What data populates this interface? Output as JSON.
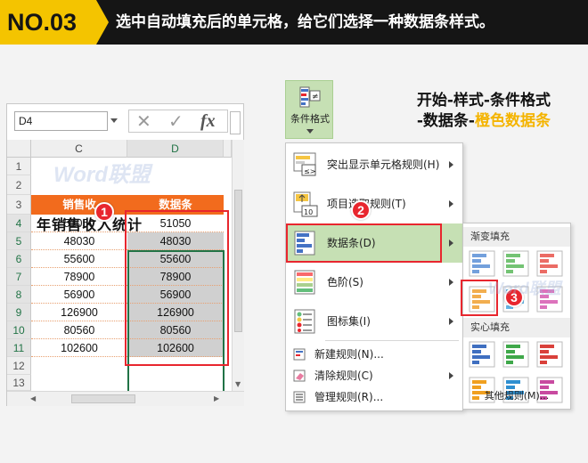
{
  "header": {
    "badge": "NO.03",
    "title": "选中自动填充后的单元格，给它们选择一种数据条样式。"
  },
  "instruction": {
    "line1": "开始-样式-条件格式",
    "line2_prefix": "-数据条-",
    "line2_highlight": "橙色数据条"
  },
  "excel": {
    "namebox": "D4",
    "formula_icons": {
      "cancel": "✕",
      "enter": "✓",
      "fx": "fx"
    },
    "columns": [
      "C",
      "D"
    ],
    "rows": [
      "1",
      "2",
      "3",
      "4",
      "5",
      "6",
      "7",
      "8",
      "9",
      "10",
      "11",
      "12",
      "13"
    ],
    "sheet_title": "年销售收入统计",
    "header_c": "销售收",
    "header_d": "数据条",
    "values": [
      "51050",
      "48030",
      "55600",
      "78900",
      "56900",
      "126900",
      "80560",
      "102600"
    ]
  },
  "ribbon": {
    "label": "条件格式"
  },
  "menu": {
    "items": [
      {
        "label": "突出显示单元格规则(H)"
      },
      {
        "label": "项目选取规则(T)"
      },
      {
        "label": "数据条(D)"
      },
      {
        "label": "色阶(S)"
      },
      {
        "label": "图标集(I)"
      }
    ],
    "small_items": [
      {
        "label": "新建规则(N)..."
      },
      {
        "label": "清除规则(C)"
      },
      {
        "label": "管理规则(R)..."
      }
    ]
  },
  "submenu": {
    "gradient_title": "渐变填充",
    "solid_title": "实心填充",
    "more": "其他规则(M)...",
    "gradient_colors": [
      "#5b8fd6",
      "#5cb85c",
      "#e8524a",
      "#f0a030",
      "#4aa8e0",
      "#d65ab0"
    ],
    "solid_colors": [
      "#3f6fc0",
      "#3fa84a",
      "#d9403a",
      "#f0a020",
      "#2f8fd0",
      "#c84aa0"
    ]
  },
  "steps": [
    "1",
    "2",
    "3"
  ],
  "watermark": "Word联盟"
}
